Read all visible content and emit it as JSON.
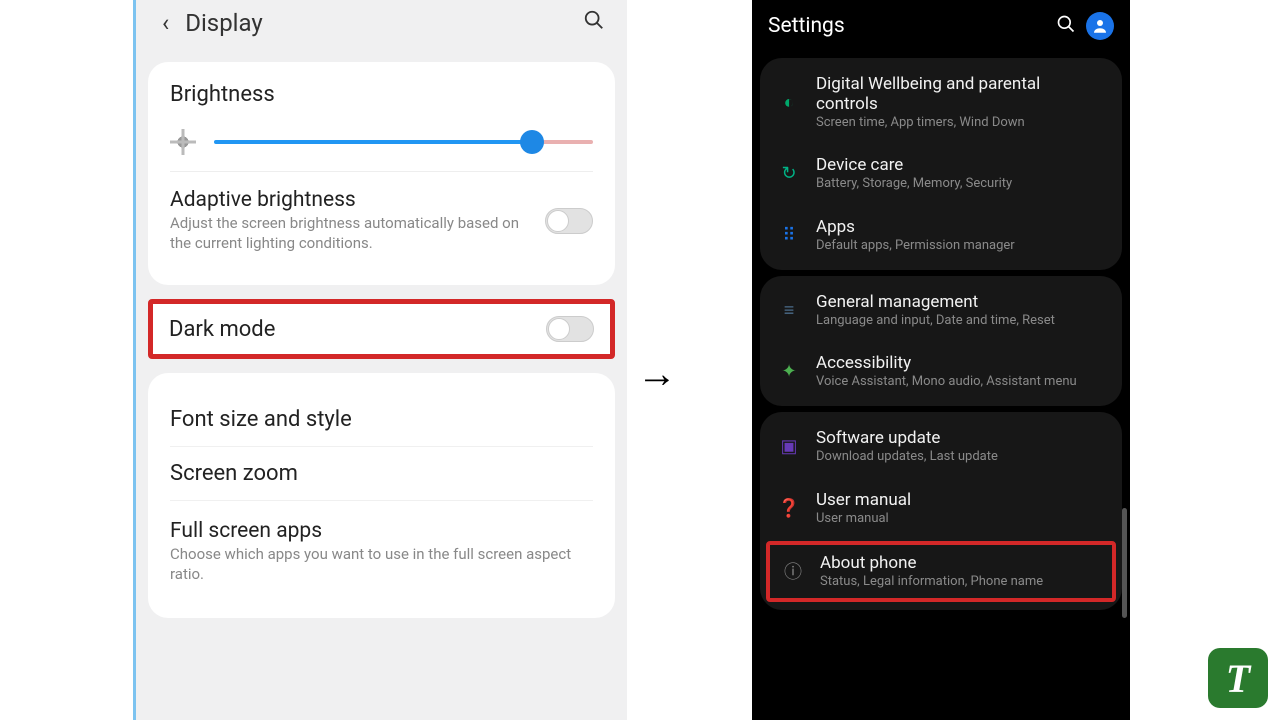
{
  "left": {
    "header": {
      "title": "Display"
    },
    "brightness": {
      "label": "Brightness"
    },
    "adaptive": {
      "title": "Adaptive brightness",
      "sub": "Adjust the screen brightness automatically based on the current lighting conditions."
    },
    "darkmode": {
      "title": "Dark mode"
    },
    "font": {
      "title": "Font size and style"
    },
    "zoom": {
      "title": "Screen zoom"
    },
    "fullscreen": {
      "title": "Full screen apps",
      "sub": "Choose which apps you want to use in the full screen aspect ratio."
    }
  },
  "right": {
    "header": {
      "title": "Settings"
    },
    "items": [
      {
        "title": "Digital Wellbeing and parental controls",
        "sub": "Screen time, App timers, Wind Down",
        "iconColor": "#00a86b",
        "icon": "◐"
      },
      {
        "title": "Device care",
        "sub": "Battery, Storage, Memory, Security",
        "iconColor": "#00b386",
        "icon": "↻"
      },
      {
        "title": "Apps",
        "sub": "Default apps, Permission manager",
        "iconColor": "#1a73e8",
        "icon": "⠿"
      }
    ],
    "items2": [
      {
        "title": "General management",
        "sub": "Language and input, Date and time, Reset",
        "iconColor": "#4a6b8a",
        "icon": "≡"
      },
      {
        "title": "Accessibility",
        "sub": "Voice Assistant, Mono audio, Assistant menu",
        "iconColor": "#4caf50",
        "icon": "✦"
      }
    ],
    "items3": [
      {
        "title": "Software update",
        "sub": "Download updates, Last update",
        "iconColor": "#673ab7",
        "icon": "▣"
      },
      {
        "title": "User manual",
        "sub": "User manual",
        "iconColor": "#f57c00",
        "icon": "❓"
      },
      {
        "title": "About phone",
        "sub": "Status, Legal information, Phone name",
        "iconColor": "#888888",
        "icon": "ⓘ",
        "highlight": true
      }
    ]
  },
  "arrow": "→",
  "watermark": "T"
}
